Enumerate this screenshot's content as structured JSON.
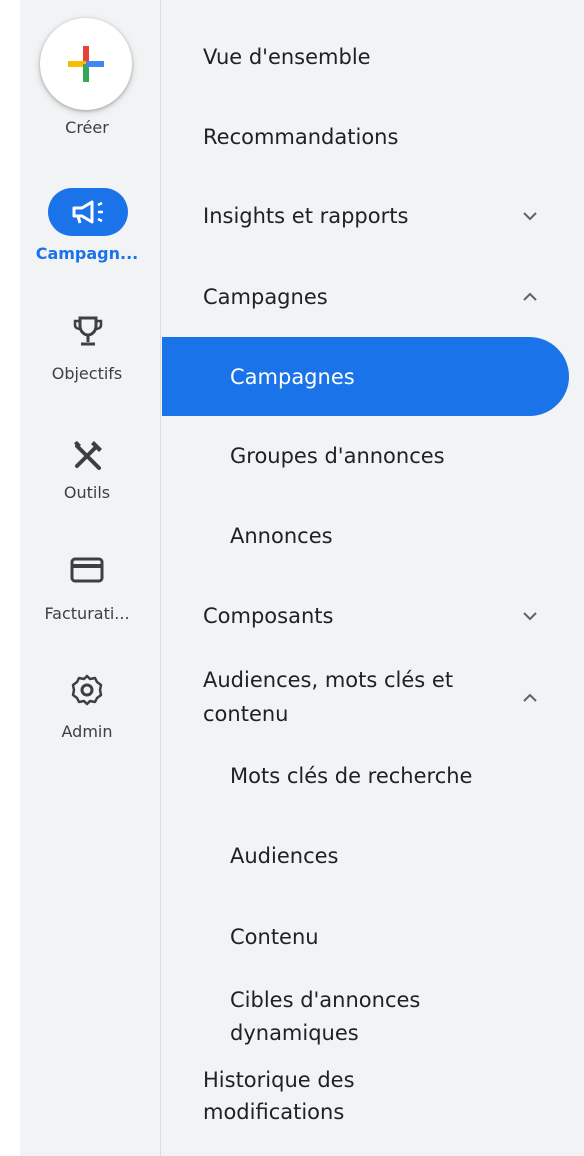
{
  "rail": {
    "create_label": "Créer",
    "items": [
      {
        "label": "Campagn...",
        "icon": "campaign-megaphone-icon",
        "active": true
      },
      {
        "label": "Objectifs",
        "icon": "trophy-icon"
      },
      {
        "label": "Outils",
        "icon": "tools-icon"
      },
      {
        "label": "Facturati...",
        "icon": "credit-card-icon"
      },
      {
        "label": "Admin",
        "icon": "gear-icon"
      }
    ]
  },
  "nav": {
    "overview": "Vue d'ensemble",
    "recommendations": "Recommandations",
    "insights": "Insights et rapports",
    "campaigns_group": "Campagnes",
    "campaigns_sub": "Campagnes",
    "ad_groups": "Groupes d'annonces",
    "ads": "Annonces",
    "assets": "Composants",
    "audiences_group_line1": "Audiences, mots clés et",
    "audiences_group_line2": "contenu",
    "search_keywords": "Mots clés de recherche",
    "audiences": "Audiences",
    "content": "Contenu",
    "dynamic_targets_line1": "Cibles d'annonces",
    "dynamic_targets_line2": "dynamiques",
    "history_line1": "Historique des",
    "history_line2": "modifications"
  },
  "colors": {
    "accent": "#1a73e8",
    "background": "#f1f3f4",
    "plus_red": "#ea4335",
    "plus_yellow": "#fbbc04",
    "plus_green": "#34a853",
    "plus_blue": "#4285f4"
  }
}
